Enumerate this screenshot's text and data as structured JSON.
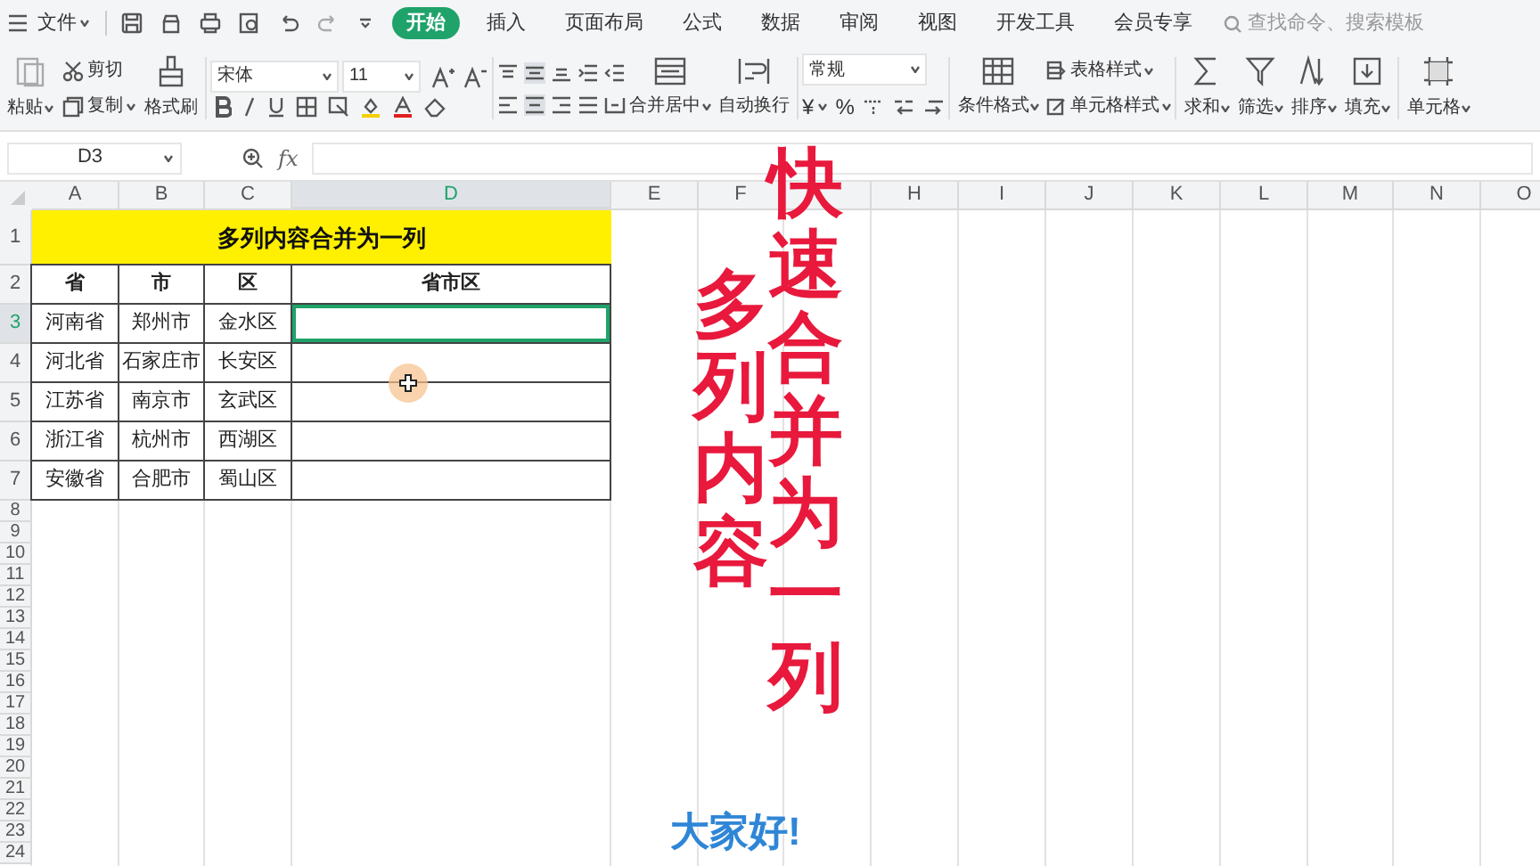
{
  "menu": {
    "file": "文件",
    "tabs": [
      {
        "label": "开始",
        "selected": true
      },
      {
        "label": "插入",
        "selected": false
      },
      {
        "label": "页面布局",
        "selected": false
      },
      {
        "label": "公式",
        "selected": false
      },
      {
        "label": "数据",
        "selected": false
      },
      {
        "label": "审阅",
        "selected": false
      },
      {
        "label": "视图",
        "selected": false
      },
      {
        "label": "开发工具",
        "selected": false
      },
      {
        "label": "会员专享",
        "selected": false
      }
    ],
    "search": {
      "placeholder": "查找命令、搜索模板"
    }
  },
  "ribbon": {
    "paste": "粘贴",
    "cut": "剪切",
    "copy": "复制",
    "format_painter": "格式刷",
    "font": "宋体",
    "size": "11",
    "merge": "合并居中",
    "wrap": "自动换行",
    "number_format": "常规",
    "currency": "¥",
    "percent": "%",
    "conditional": "条件格式",
    "table_style": "表格样式",
    "cell_style": "单元格样式",
    "tools": [
      "求和",
      "筛选",
      "排序",
      "填充",
      "单元格"
    ]
  },
  "formula_bar": {
    "name_box": "D3",
    "fx": "fx"
  },
  "columns": [
    {
      "label": "A",
      "selected": false
    },
    {
      "label": "B",
      "selected": false
    },
    {
      "label": "C",
      "selected": false
    },
    {
      "label": "D",
      "selected": true
    },
    {
      "label": "E",
      "selected": false
    },
    {
      "label": "F",
      "selected": false
    },
    {
      "selected": false
    },
    {
      "label": "H",
      "selected": false
    },
    {
      "label": "I",
      "selected": false
    },
    {
      "label": "J",
      "selected": false
    },
    {
      "label": "K",
      "selected": false
    },
    {
      "label": "L",
      "selected": false
    },
    {
      "label": "M",
      "selected": false
    },
    {
      "label": "N",
      "selected": false
    },
    {
      "label": "O",
      "selected": false
    }
  ],
  "rows": [
    {
      "header": "1",
      "selected": false,
      "kind": "title",
      "cells": [
        "多列内容合并为一列"
      ]
    },
    {
      "header": "2",
      "selected": false,
      "kind": "heading",
      "cells": [
        "省",
        "市",
        "区",
        "省市区"
      ]
    },
    {
      "header": "3",
      "selected": true,
      "kind": "data",
      "cells": [
        "河南省",
        "郑州市",
        "金水区"
      ]
    },
    {
      "header": "4",
      "selected": false,
      "kind": "data",
      "cells": [
        "河北省",
        "石家庄市",
        "长安区"
      ]
    },
    {
      "header": "5",
      "selected": false,
      "kind": "data",
      "cells": [
        "江苏省",
        "南京市",
        "玄武区"
      ]
    },
    {
      "header": "6",
      "selected": false,
      "kind": "data",
      "cells": [
        "浙江省",
        "杭州市",
        "西湖区"
      ]
    },
    {
      "header": "7",
      "selected": false,
      "kind": "data",
      "cells": [
        "安徽省",
        "合肥市",
        "蜀山区"
      ]
    },
    {
      "header": "8",
      "selected": false,
      "kind": "empty"
    },
    {
      "header": "9",
      "selected": false,
      "kind": "empty"
    },
    {
      "header": "10",
      "selected": false,
      "kind": "empty"
    },
    {
      "header": "11",
      "selected": false,
      "kind": "empty"
    },
    {
      "header": "12",
      "selected": false,
      "kind": "empty"
    },
    {
      "header": "13",
      "selected": false,
      "kind": "empty"
    },
    {
      "header": "14",
      "selected": false,
      "kind": "empty"
    },
    {
      "header": "15",
      "selected": false,
      "kind": "empty"
    },
    {
      "header": "16",
      "selected": false,
      "kind": "empty"
    },
    {
      "header": "17",
      "selected": false,
      "kind": "empty"
    },
    {
      "header": "18",
      "selected": false,
      "kind": "empty"
    },
    {
      "header": "19",
      "selected": false,
      "kind": "empty"
    },
    {
      "header": "20",
      "selected": false,
      "kind": "empty"
    },
    {
      "header": "21",
      "selected": false,
      "kind": "empty"
    },
    {
      "header": "22",
      "selected": false,
      "kind": "empty"
    },
    {
      "header": "23",
      "selected": false,
      "kind": "empty"
    },
    {
      "header": "24",
      "selected": false,
      "kind": "empty"
    }
  ],
  "captions": [
    {
      "text": "多列内容",
      "kind": "vertical"
    },
    {
      "text": "快速合并为一列",
      "kind": "vertical"
    },
    {
      "text": "大家好!",
      "kind": "subtitle"
    }
  ]
}
